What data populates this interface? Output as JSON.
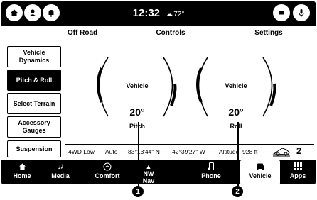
{
  "status": {
    "time": "12:32",
    "temperature": "72°",
    "weather_icon": "sun-cloud-icon"
  },
  "tabs": [
    {
      "label": "Off Road",
      "active": true
    },
    {
      "label": "Controls",
      "active": false
    },
    {
      "label": "Settings",
      "active": false
    }
  ],
  "sidebar": {
    "items": [
      {
        "label": "Vehicle Dynamics",
        "active": false
      },
      {
        "label": "Pitch & Roll",
        "active": true
      },
      {
        "label": "Select Terrain",
        "active": false
      },
      {
        "label": "Accessory Gauges",
        "active": false
      },
      {
        "label": "Suspension",
        "active": false
      }
    ]
  },
  "gauges": {
    "pitch": {
      "label": "Vehicle",
      "value": "20°",
      "name": "Pitch"
    },
    "roll": {
      "label": "Vehicle",
      "value": "20°",
      "name": "Roll"
    }
  },
  "info": {
    "drive_mode": "4WD Low",
    "transfer": "Auto",
    "longitude": "83°13'44\" N",
    "latitude": "42°39'27\" W",
    "altitude": "Altitude: 928 ft",
    "gear": "2"
  },
  "nav": {
    "items": [
      {
        "label": "Home",
        "icon": "home-icon",
        "active": false
      },
      {
        "label": "Media",
        "icon": "music-note-icon",
        "active": false
      },
      {
        "label": "Comfort",
        "icon": "comfort-icon",
        "active": false
      },
      {
        "label": "Nav",
        "icon": "compass-icon",
        "active": false
      },
      {
        "label": "Phone",
        "icon": "phone-icon",
        "active": false
      },
      {
        "label": "Vehicle",
        "icon": "vehicle-icon",
        "active": true
      },
      {
        "label": "Apps",
        "icon": "apps-grid-icon",
        "active": false
      }
    ],
    "compass_heading": "NW"
  },
  "callouts": [
    "1",
    "2"
  ]
}
